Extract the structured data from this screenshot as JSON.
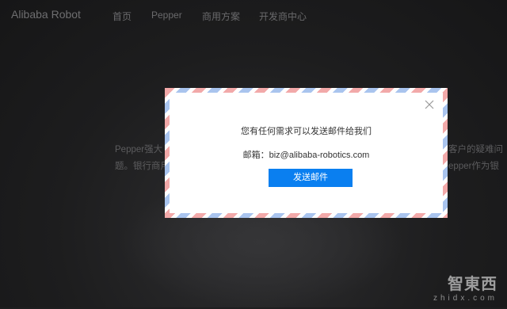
{
  "nav": {
    "logo": "Alibaba Robot",
    "items": [
      "首页",
      "Pepper",
      "商用方案",
      "开发商中心"
    ]
  },
  "background": {
    "left_line1": "Pepper强大",
    "left_line2": "题。银行商用",
    "right_line1": "客户的疑难问",
    "right_line2": "epper作为银"
  },
  "modal": {
    "message": "您有任何需求可以发送邮件给我们",
    "email_label": "邮箱：",
    "email": "biz@alibaba-robotics.com",
    "send_label": "发送邮件"
  },
  "watermark": {
    "main": "智東西",
    "sub": "zhidx.com"
  }
}
